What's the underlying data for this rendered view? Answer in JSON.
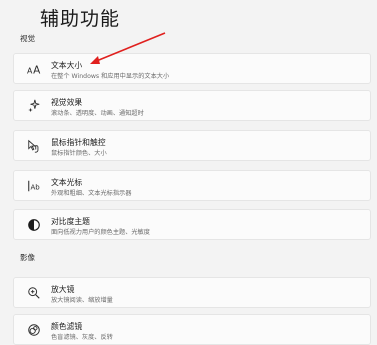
{
  "page": {
    "title": "辅助功能"
  },
  "sections": {
    "vision": "视觉",
    "audio": "影像"
  },
  "items": [
    {
      "title": "文本大小",
      "desc": "在整个 Windows 和应用中显示的文本大小",
      "icon": "text-size-icon"
    },
    {
      "title": "视觉效果",
      "desc": "滚动条、透明度、动画、通知超时",
      "icon": "sparkle-icon"
    },
    {
      "title": "鼠标指针和触控",
      "desc": "鼠标指针颜色、大小",
      "icon": "pointer-touch-icon"
    },
    {
      "title": "文本光标",
      "desc": "外观和粗细、文本光标指示器",
      "icon": "text-cursor-icon"
    },
    {
      "title": "对比度主题",
      "desc": "面向低视力用户的颜色主题、光敏度",
      "icon": "contrast-icon"
    },
    {
      "title": "放大镜",
      "desc": "放大镜阅读、缩放增量",
      "icon": "magnifier-icon"
    },
    {
      "title": "颜色滤镜",
      "desc": "色盲滤镜、灰度、反转",
      "icon": "color-filter-icon"
    }
  ],
  "colors": {
    "annotation_arrow": "#e0201e"
  }
}
